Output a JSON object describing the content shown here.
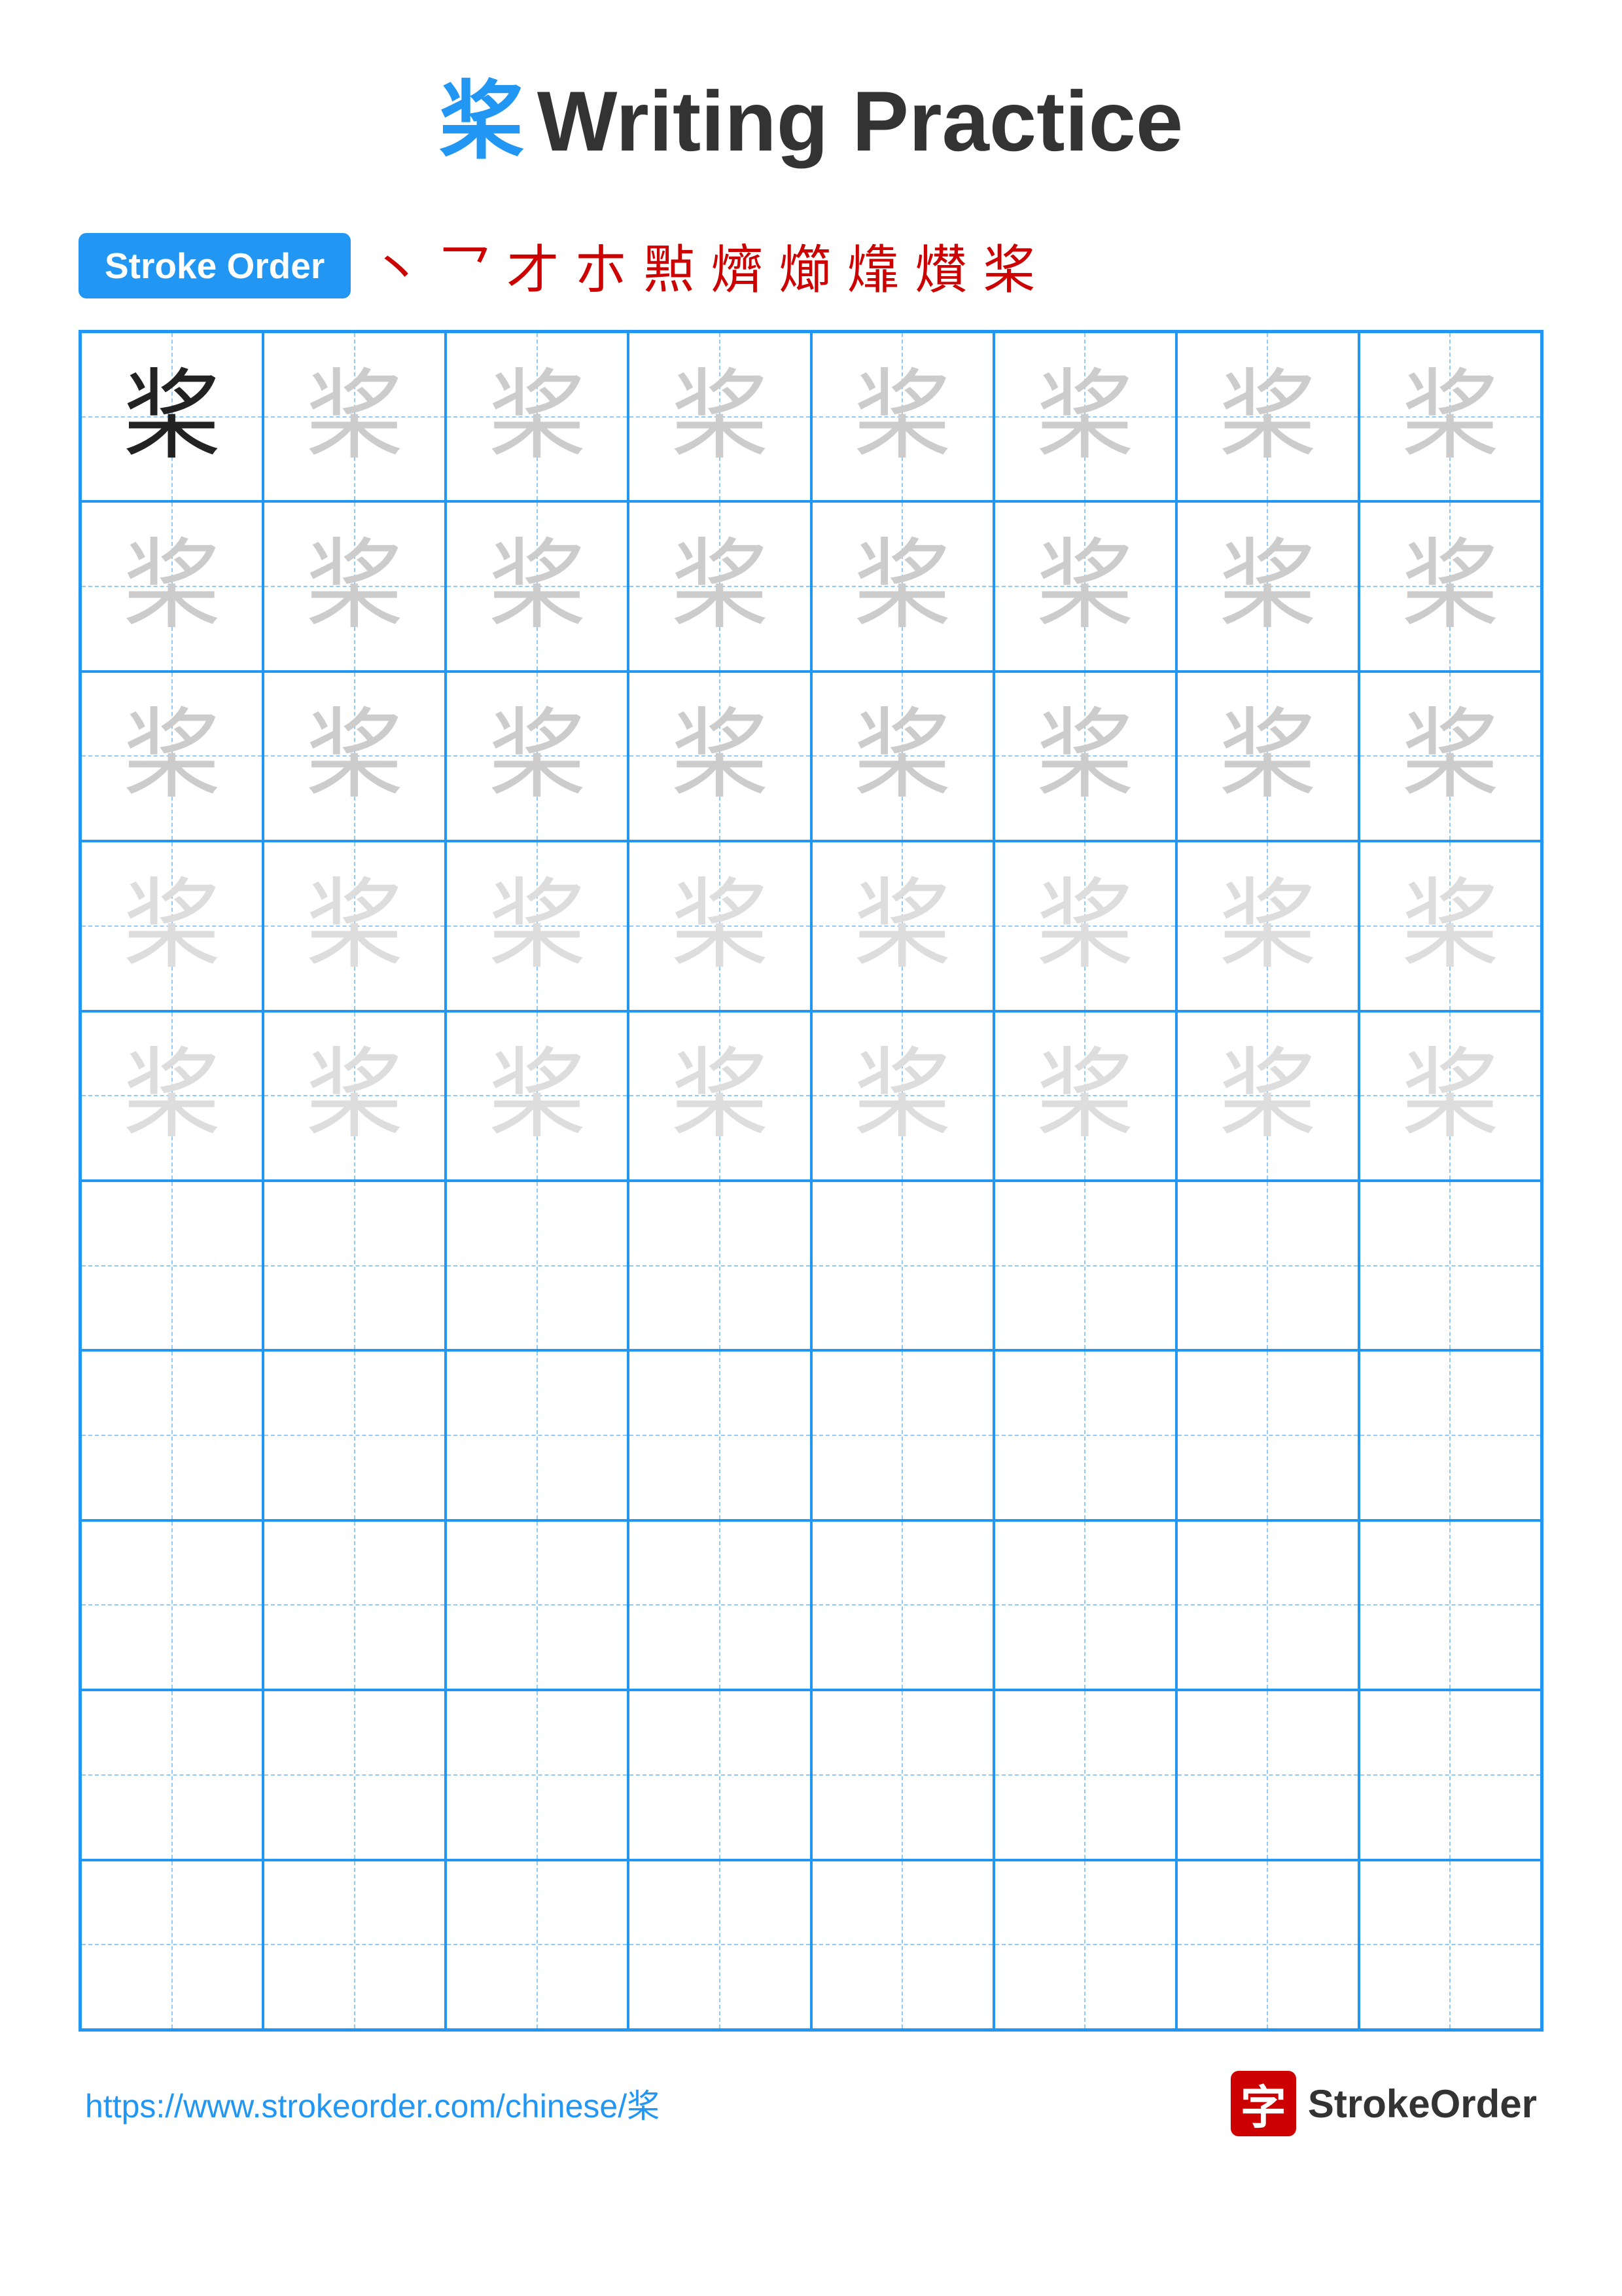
{
  "title": {
    "char": "桨",
    "text": "Writing Practice"
  },
  "stroke_order": {
    "badge_label": "Stroke Order",
    "strokes": [
      "、",
      "乙",
      "𠃊",
      "𠃍",
      "㸃",
      "㸃",
      "㸆",
      "㸇",
      "㸈",
      "桨"
    ]
  },
  "grid": {
    "rows": 10,
    "cols": 8,
    "char": "桨",
    "practice_rows_with_char": 5,
    "practice_rows_empty": 5
  },
  "footer": {
    "url": "https://www.strokeorder.com/chinese/桨",
    "logo_char": "字",
    "logo_brand": "StrokeOrder"
  }
}
